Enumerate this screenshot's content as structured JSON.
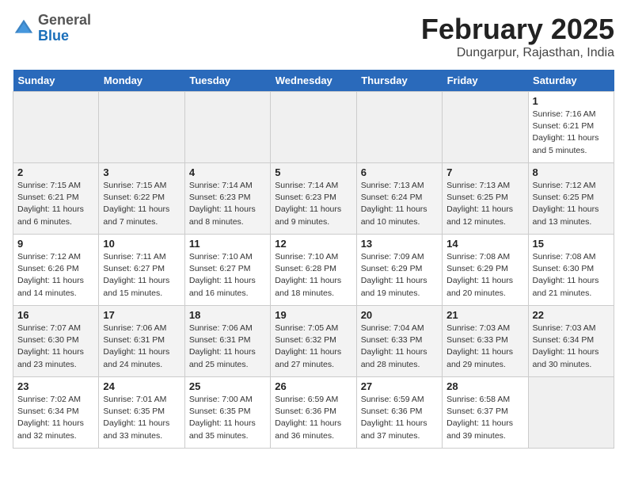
{
  "header": {
    "logo_general": "General",
    "logo_blue": "Blue",
    "title": "February 2025",
    "subtitle": "Dungarpur, Rajasthan, India"
  },
  "weekdays": [
    "Sunday",
    "Monday",
    "Tuesday",
    "Wednesday",
    "Thursday",
    "Friday",
    "Saturday"
  ],
  "weeks": [
    [
      {
        "day": "",
        "info": ""
      },
      {
        "day": "",
        "info": ""
      },
      {
        "day": "",
        "info": ""
      },
      {
        "day": "",
        "info": ""
      },
      {
        "day": "",
        "info": ""
      },
      {
        "day": "",
        "info": ""
      },
      {
        "day": "1",
        "info": "Sunrise: 7:16 AM\nSunset: 6:21 PM\nDaylight: 11 hours\nand 5 minutes."
      }
    ],
    [
      {
        "day": "2",
        "info": "Sunrise: 7:15 AM\nSunset: 6:21 PM\nDaylight: 11 hours\nand 6 minutes."
      },
      {
        "day": "3",
        "info": "Sunrise: 7:15 AM\nSunset: 6:22 PM\nDaylight: 11 hours\nand 7 minutes."
      },
      {
        "day": "4",
        "info": "Sunrise: 7:14 AM\nSunset: 6:23 PM\nDaylight: 11 hours\nand 8 minutes."
      },
      {
        "day": "5",
        "info": "Sunrise: 7:14 AM\nSunset: 6:23 PM\nDaylight: 11 hours\nand 9 minutes."
      },
      {
        "day": "6",
        "info": "Sunrise: 7:13 AM\nSunset: 6:24 PM\nDaylight: 11 hours\nand 10 minutes."
      },
      {
        "day": "7",
        "info": "Sunrise: 7:13 AM\nSunset: 6:25 PM\nDaylight: 11 hours\nand 12 minutes."
      },
      {
        "day": "8",
        "info": "Sunrise: 7:12 AM\nSunset: 6:25 PM\nDaylight: 11 hours\nand 13 minutes."
      }
    ],
    [
      {
        "day": "9",
        "info": "Sunrise: 7:12 AM\nSunset: 6:26 PM\nDaylight: 11 hours\nand 14 minutes."
      },
      {
        "day": "10",
        "info": "Sunrise: 7:11 AM\nSunset: 6:27 PM\nDaylight: 11 hours\nand 15 minutes."
      },
      {
        "day": "11",
        "info": "Sunrise: 7:10 AM\nSunset: 6:27 PM\nDaylight: 11 hours\nand 16 minutes."
      },
      {
        "day": "12",
        "info": "Sunrise: 7:10 AM\nSunset: 6:28 PM\nDaylight: 11 hours\nand 18 minutes."
      },
      {
        "day": "13",
        "info": "Sunrise: 7:09 AM\nSunset: 6:29 PM\nDaylight: 11 hours\nand 19 minutes."
      },
      {
        "day": "14",
        "info": "Sunrise: 7:08 AM\nSunset: 6:29 PM\nDaylight: 11 hours\nand 20 minutes."
      },
      {
        "day": "15",
        "info": "Sunrise: 7:08 AM\nSunset: 6:30 PM\nDaylight: 11 hours\nand 21 minutes."
      }
    ],
    [
      {
        "day": "16",
        "info": "Sunrise: 7:07 AM\nSunset: 6:30 PM\nDaylight: 11 hours\nand 23 minutes."
      },
      {
        "day": "17",
        "info": "Sunrise: 7:06 AM\nSunset: 6:31 PM\nDaylight: 11 hours\nand 24 minutes."
      },
      {
        "day": "18",
        "info": "Sunrise: 7:06 AM\nSunset: 6:31 PM\nDaylight: 11 hours\nand 25 minutes."
      },
      {
        "day": "19",
        "info": "Sunrise: 7:05 AM\nSunset: 6:32 PM\nDaylight: 11 hours\nand 27 minutes."
      },
      {
        "day": "20",
        "info": "Sunrise: 7:04 AM\nSunset: 6:33 PM\nDaylight: 11 hours\nand 28 minutes."
      },
      {
        "day": "21",
        "info": "Sunrise: 7:03 AM\nSunset: 6:33 PM\nDaylight: 11 hours\nand 29 minutes."
      },
      {
        "day": "22",
        "info": "Sunrise: 7:03 AM\nSunset: 6:34 PM\nDaylight: 11 hours\nand 30 minutes."
      }
    ],
    [
      {
        "day": "23",
        "info": "Sunrise: 7:02 AM\nSunset: 6:34 PM\nDaylight: 11 hours\nand 32 minutes."
      },
      {
        "day": "24",
        "info": "Sunrise: 7:01 AM\nSunset: 6:35 PM\nDaylight: 11 hours\nand 33 minutes."
      },
      {
        "day": "25",
        "info": "Sunrise: 7:00 AM\nSunset: 6:35 PM\nDaylight: 11 hours\nand 35 minutes."
      },
      {
        "day": "26",
        "info": "Sunrise: 6:59 AM\nSunset: 6:36 PM\nDaylight: 11 hours\nand 36 minutes."
      },
      {
        "day": "27",
        "info": "Sunrise: 6:59 AM\nSunset: 6:36 PM\nDaylight: 11 hours\nand 37 minutes."
      },
      {
        "day": "28",
        "info": "Sunrise: 6:58 AM\nSunset: 6:37 PM\nDaylight: 11 hours\nand 39 minutes."
      },
      {
        "day": "",
        "info": ""
      }
    ]
  ]
}
